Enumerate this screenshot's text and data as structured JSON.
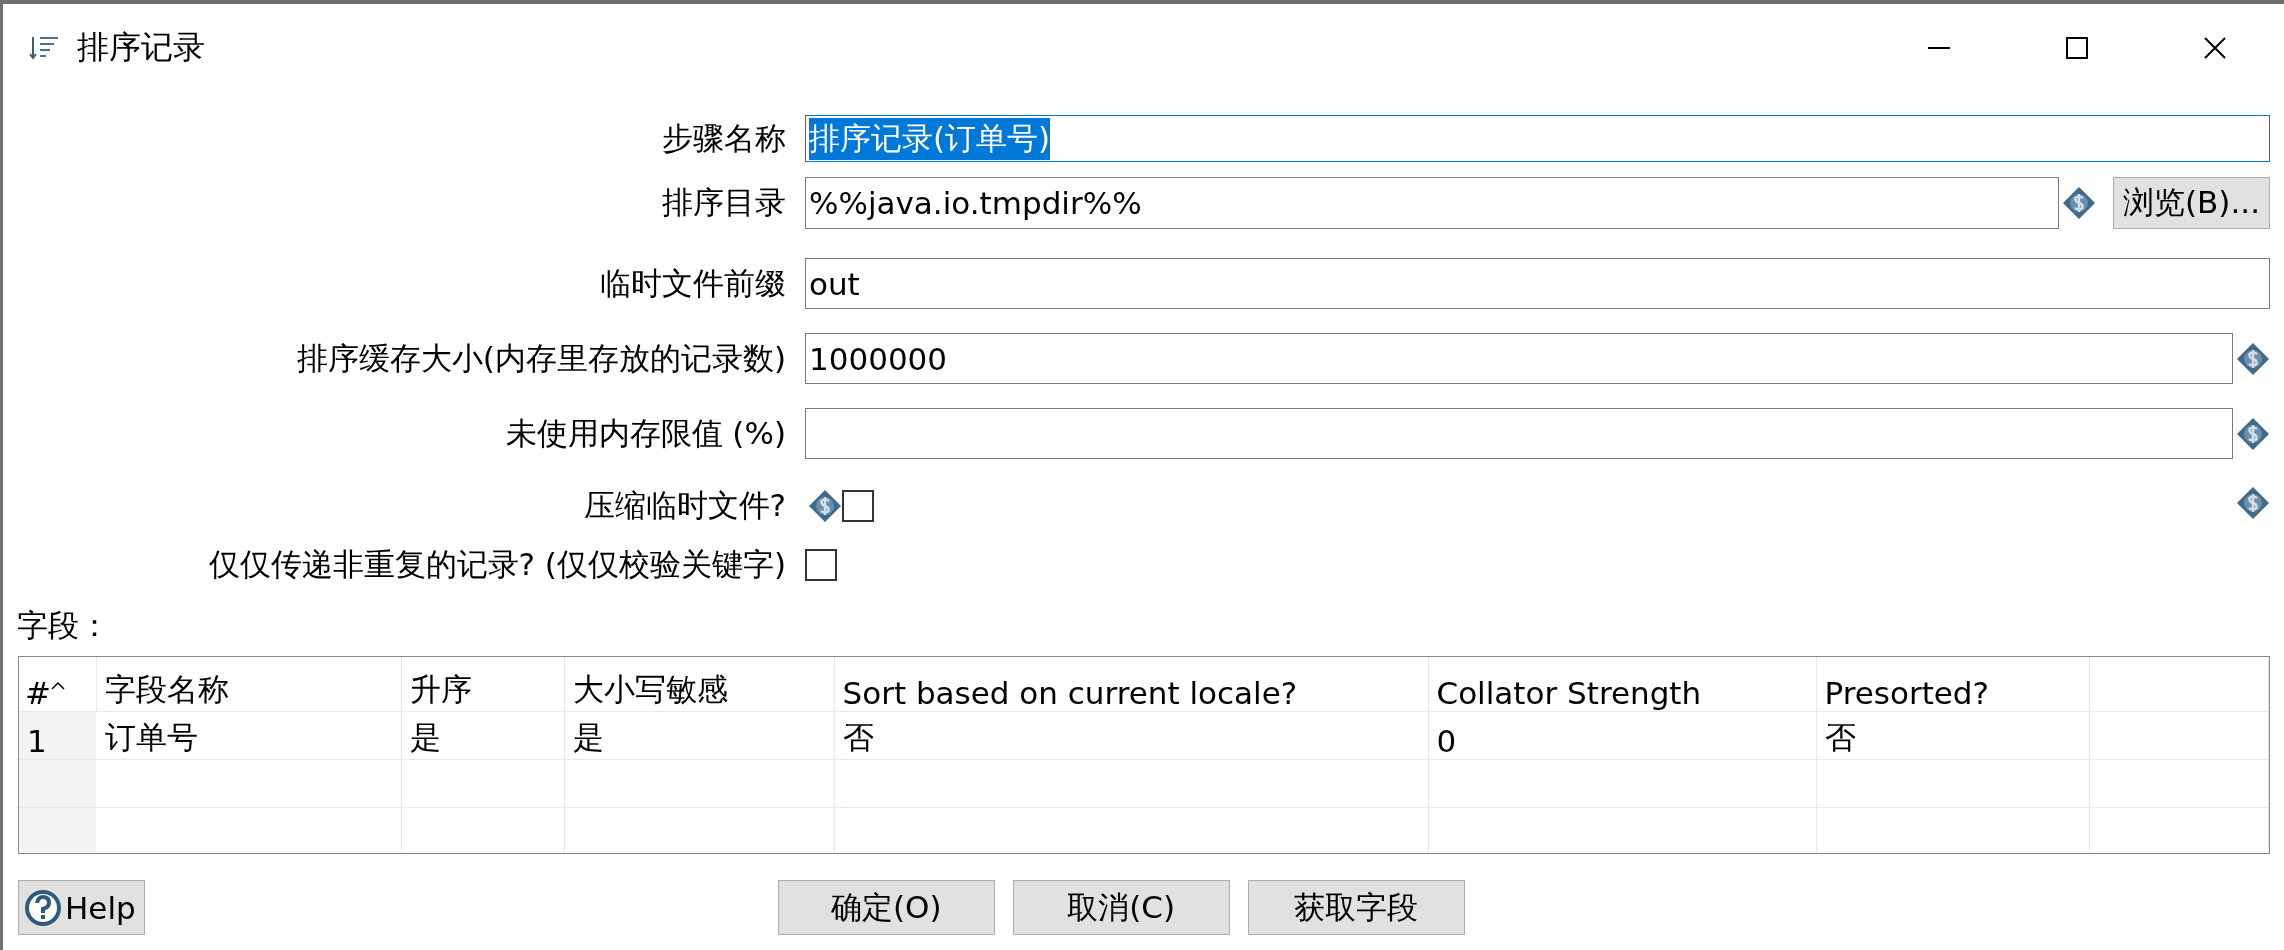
{
  "window": {
    "title": "排序记录"
  },
  "form": {
    "fields": [
      {
        "kind": "text",
        "label": "步骤名称",
        "value": "排序记录(订单号)",
        "focused": true,
        "text_selected": true,
        "variable": false,
        "trailing_variable": false
      },
      {
        "kind": "text",
        "label": "排序目录",
        "value": "%%java.io.tmpdir%%",
        "focused": false,
        "text_selected": false,
        "variable": true,
        "trailing_variable": false,
        "button": "浏览(B)..."
      },
      {
        "kind": "text",
        "label": "临时文件前缀",
        "value": "out",
        "focused": false,
        "text_selected": false,
        "variable": false,
        "trailing_variable": false
      },
      {
        "kind": "text",
        "label": "排序缓存大小(内存里存放的记录数)",
        "value": "1000000",
        "focused": false,
        "text_selected": false,
        "variable": true,
        "trailing_variable": false
      },
      {
        "kind": "text",
        "label": "未使用内存限值 (%)",
        "focused": false,
        "variable": true,
        "trailing_variable": false
      },
      {
        "kind": "checkbox",
        "label": "压缩临时文件?",
        "checked": false,
        "variable": true,
        "trailing_variable": true
      },
      {
        "kind": "checkbox",
        "label": "仅仅传递非重复的记录? (仅仅校验关键字)",
        "checked": false,
        "variable": false,
        "trailing_variable": false
      }
    ]
  },
  "table": {
    "title": "字段：",
    "columns": [
      {
        "label": "#",
        "sorted": true
      },
      {
        "label": "字段名称",
        "sorted": false
      },
      {
        "label": "升序",
        "sorted": false
      },
      {
        "label": "大小写敏感",
        "sorted": false
      },
      {
        "label": "Sort based on current locale?",
        "sorted": false
      },
      {
        "label": "Collator Strength",
        "sorted": false
      },
      {
        "label": "Presorted?",
        "sorted": false
      }
    ],
    "rows": [
      {
        "cells": [
          "1",
          "订单号",
          "是",
          "是",
          "否",
          "0",
          "否"
        ]
      }
    ]
  },
  "buttons": {
    "help": "Help",
    "actions": [
      "确定(O)",
      "取消(C)",
      "获取字段"
    ]
  }
}
